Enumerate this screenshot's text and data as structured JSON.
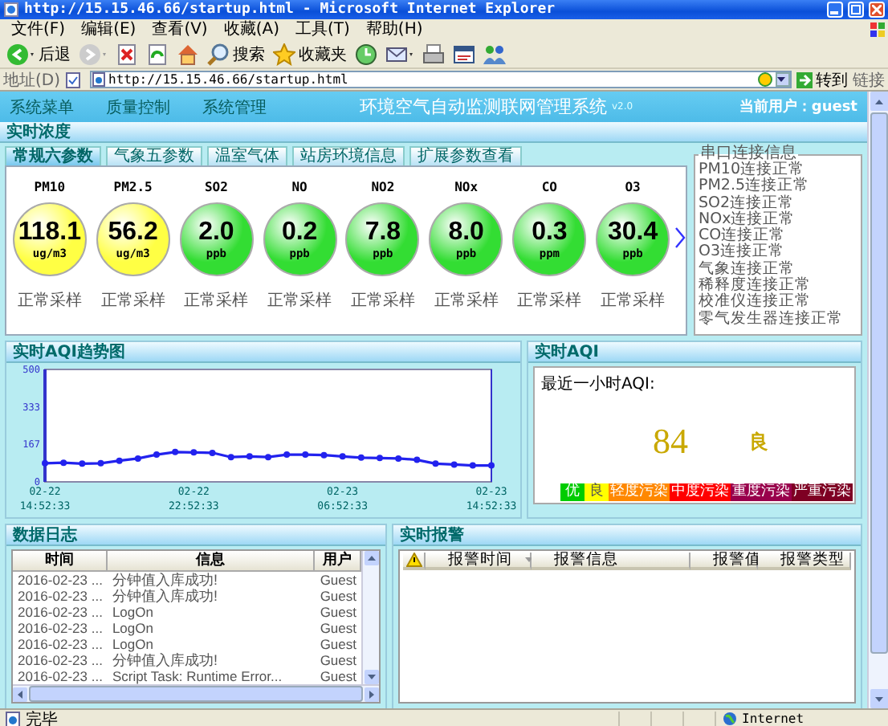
{
  "window": {
    "title": "http://15.15.46.66/startup.html - Microsoft Internet Explorer"
  },
  "menu": [
    "文件(F)",
    "编辑(E)",
    "查看(V)",
    "收藏(A)",
    "工具(T)",
    "帮助(H)"
  ],
  "toolbar": [
    {
      "kind": "back",
      "label": "后退"
    },
    {
      "kind": "forward"
    },
    {
      "kind": "stop"
    },
    {
      "kind": "refresh"
    },
    {
      "kind": "home"
    },
    {
      "kind": "search",
      "label": "搜索"
    },
    {
      "kind": "favorites",
      "label": "收藏夹"
    },
    {
      "kind": "history"
    },
    {
      "kind": "mail"
    },
    {
      "kind": "print"
    },
    {
      "kind": "edit"
    },
    {
      "kind": "messenger"
    }
  ],
  "address": {
    "label": "地址(D)",
    "value": "http://15.15.46.66/startup.html",
    "go": "转到",
    "links": "链接"
  },
  "header": {
    "nav": [
      "系统菜单",
      "质量控制",
      "系统管理"
    ],
    "title": "环境空气自动监测联网管理系统",
    "version": "v2.0",
    "user": "当前用户：guest"
  },
  "concentration": {
    "title": "实时浓度",
    "tabs": [
      {
        "label": "常规六参数",
        "selected": true
      },
      {
        "label": "气象五参数",
        "selected": false
      },
      {
        "label": "温室气体",
        "selected": false
      },
      {
        "label": "站房环境信息",
        "selected": false
      },
      {
        "label": "扩展参数查看",
        "selected": false
      }
    ],
    "gauges": [
      {
        "name": "PM10",
        "value": "118.1",
        "unit": "ug/m3",
        "status": "正常采样",
        "color": "#ffff44"
      },
      {
        "name": "PM2.5",
        "value": "56.2",
        "unit": "ug/m3",
        "status": "正常采样",
        "color": "#ffff44"
      },
      {
        "name": "SO2",
        "value": "2.0",
        "unit": "ppb",
        "status": "正常采样",
        "color": "#33dd33"
      },
      {
        "name": "NO",
        "value": "0.2",
        "unit": "ppb",
        "status": "正常采样",
        "color": "#33dd33"
      },
      {
        "name": "NO2",
        "value": "7.8",
        "unit": "ppb",
        "status": "正常采样",
        "color": "#33dd33"
      },
      {
        "name": "NOx",
        "value": "8.0",
        "unit": "ppb",
        "status": "正常采样",
        "color": "#33dd33"
      },
      {
        "name": "CO",
        "value": "0.3",
        "unit": "ppm",
        "status": "正常采样",
        "color": "#33dd33"
      },
      {
        "name": "O3",
        "value": "30.4",
        "unit": "ppb",
        "status": "正常采样",
        "color": "#33dd33"
      }
    ],
    "serial": {
      "title": "串口连接信息",
      "items": [
        "PM10连接正常",
        "PM2.5连接正常",
        "SO2连接正常",
        "NOx连接正常",
        "CO连接正常",
        "O3连接正常",
        "气象连接正常",
        "稀释度连接正常",
        "校准仪连接正常",
        "零气发生器连接正常"
      ]
    }
  },
  "trend": {
    "title": "实时AQI趋势图",
    "chart_data": {
      "type": "line",
      "ylim": [
        0,
        500
      ],
      "yticks": [
        0,
        167,
        333,
        500
      ],
      "categories": [
        "02-22 14:52:33",
        null,
        null,
        null,
        null,
        null,
        null,
        null,
        "02-22 22:52:33",
        null,
        null,
        null,
        null,
        null,
        null,
        null,
        "02-23 06:52:33",
        null,
        null,
        null,
        null,
        null,
        null,
        null,
        "02-23 14:52:33"
      ],
      "series": [
        {
          "color": "#2222ee",
          "marker": "circle",
          "values": [
            83,
            85,
            81,
            83,
            94,
            104,
            121,
            133,
            131,
            129,
            110,
            113,
            110,
            121,
            121,
            119,
            113,
            108,
            106,
            104,
            98,
            81,
            77,
            73,
            73
          ]
        }
      ]
    }
  },
  "aqi": {
    "title": "实时AQI",
    "caption": "最近一小时AQI:",
    "value": "84",
    "grade": "良",
    "legend": [
      {
        "label": "优",
        "color": "#00cc00"
      },
      {
        "label": "良",
        "color": "#ffff00"
      },
      {
        "label": "轻度污染",
        "color": "#ff8800"
      },
      {
        "label": "中度污染",
        "color": "#ff0000"
      },
      {
        "label": "重度污染",
        "color": "#99004c"
      },
      {
        "label": "严重污染",
        "color": "#7e0023"
      }
    ]
  },
  "log": {
    "title": "数据日志",
    "columns": [
      "时间",
      "信息",
      "用户"
    ],
    "rows": [
      {
        "time": "2016-02-23 ...",
        "message": "分钟值入库成功!",
        "user": "Guest"
      },
      {
        "time": "2016-02-23 ...",
        "message": "分钟值入库成功!",
        "user": "Guest"
      },
      {
        "time": "2016-02-23 ...",
        "message": "LogOn",
        "user": "Guest"
      },
      {
        "time": "2016-02-23 ...",
        "message": "LogOn",
        "user": "Guest"
      },
      {
        "time": "2016-02-23 ...",
        "message": "LogOn",
        "user": "Guest"
      },
      {
        "time": "2016-02-23 ...",
        "message": "分钟值入库成功!",
        "user": "Guest"
      },
      {
        "time": "2016-02-23 ...",
        "message": "Script Task: Runtime Error...",
        "user": "Guest"
      }
    ]
  },
  "alarm": {
    "title": "实时报警",
    "columns": [
      "报警时间",
      "报警信息",
      "报警值",
      "报警类型"
    ]
  },
  "status_bar": {
    "text": "完毕",
    "zone": "Internet"
  }
}
